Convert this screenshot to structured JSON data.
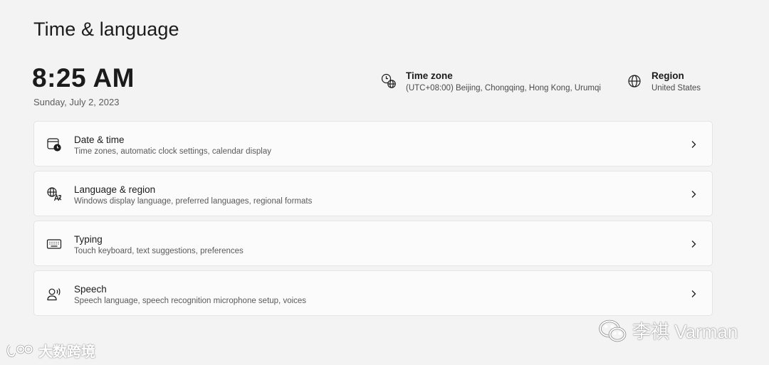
{
  "page": {
    "title": "Time & language"
  },
  "clock": {
    "time": "8:25 AM",
    "date": "Sunday, July 2, 2023"
  },
  "summary": {
    "time_zone": {
      "title": "Time zone",
      "value": "(UTC+08:00) Beijing, Chongqing, Hong Kong, Urumqi",
      "icon": "clock-globe-icon"
    },
    "region": {
      "title": "Region",
      "value": "United States",
      "icon": "globe-icon"
    }
  },
  "settings": [
    {
      "title": "Date & time",
      "subtitle": "Time zones, automatic clock settings, calendar display",
      "icon": "calendar-clock-icon"
    },
    {
      "title": "Language & region",
      "subtitle": "Windows display language, preferred languages, regional formats",
      "icon": "language-icon"
    },
    {
      "title": "Typing",
      "subtitle": "Touch keyboard, text suggestions, preferences",
      "icon": "keyboard-icon"
    },
    {
      "title": "Speech",
      "subtitle": "Speech language, speech recognition microphone setup, voices",
      "icon": "speech-icon"
    }
  ],
  "watermarks": {
    "left": "大数跨境",
    "right": "李祺 Varman"
  },
  "colors": {
    "background": "#f3f3f3",
    "card": "#fbfbfb",
    "card_border": "#e5e5e5",
    "text_primary": "#1b1b1b",
    "text_secondary": "#5a5a5a"
  }
}
